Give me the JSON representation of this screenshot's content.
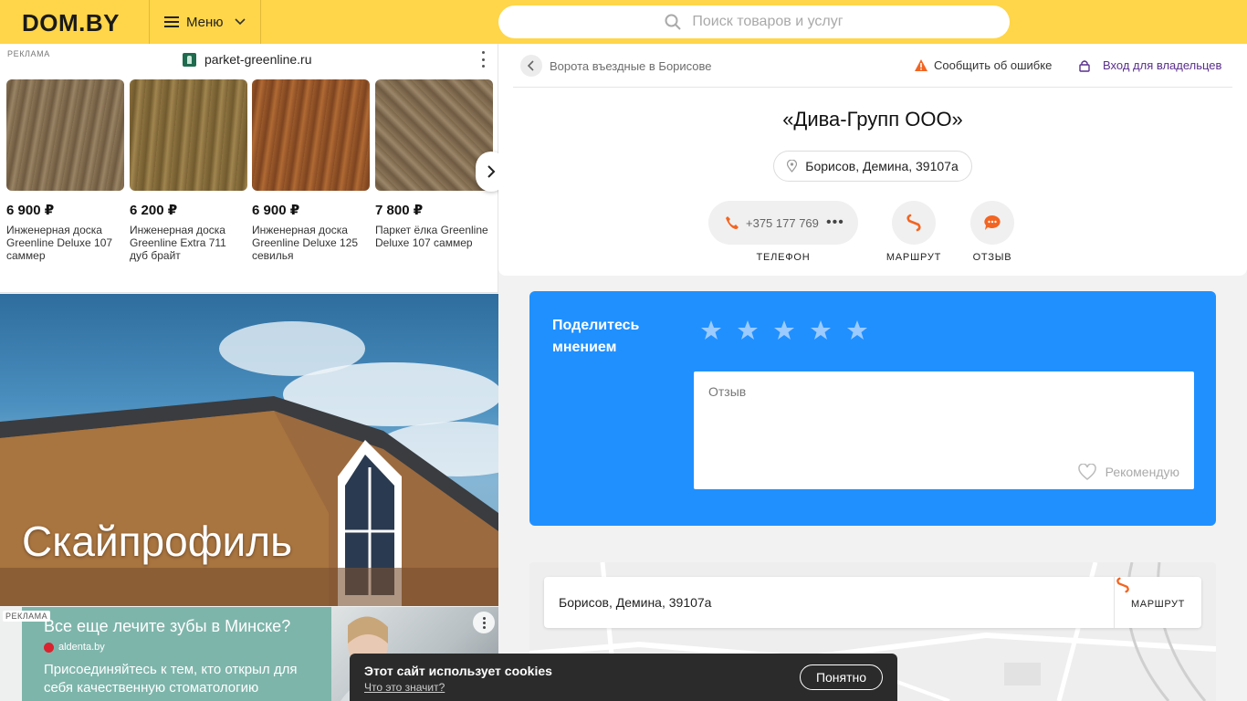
{
  "header": {
    "logo": "DOM.BY",
    "menu_label": "Меню",
    "search_placeholder": "Поиск товаров и услуг"
  },
  "ad_top": {
    "label": "РЕКЛАМА",
    "domain": "parket-greenline.ru",
    "products": [
      {
        "price": "6 900 ₽",
        "name": "Инженерная доска Greenline Deluxe 107 саммер"
      },
      {
        "price": "6 200 ₽",
        "name": "Инженерная доска Greenline Extra 711 дуб брайт"
      },
      {
        "price": "6 900 ₽",
        "name": "Инженерная доска Greenline Deluxe 125 севилья"
      },
      {
        "price": "7 800 ₽",
        "name": "Паркет ёлка Greenline Deluxe 107 саммер"
      }
    ]
  },
  "banner": {
    "title": "Скайпрофиль"
  },
  "ad_bottom": {
    "label": "РЕКЛАМА",
    "title": "Все еще лечите зубы в Минске?",
    "domain": "aldenta.by",
    "text": "Присоединяйтесь к тем, кто открыл для себя качественную стоматологию"
  },
  "company_card": {
    "breadcrumb": "Ворота въездные в Борисове",
    "report_label": "Сообщить об ошибке",
    "owner_label": "Вход для владельцев",
    "name": "«Дива-Групп ООО»",
    "address": "Борисов, Демина, 39107а",
    "phone": "+375 177 769",
    "phone_label": "ТЕЛЕФОН",
    "route_label": "МАРШРУТ",
    "review_label": "ОТЗЫВ"
  },
  "review_form": {
    "title": "Поделитесь мнением",
    "placeholder": "Отзыв",
    "recommend_label": "Рекомендую"
  },
  "map": {
    "address": "Борисов, Демина, 39107а",
    "route_label": "МАРШРУТ"
  },
  "cookie": {
    "title": "Этот сайт использует cookies",
    "link": "Что это значит?",
    "button": "Понятно"
  },
  "colors": {
    "header_bg": "#ffd649",
    "accent_orange": "#f26522",
    "review_blue": "#2090ff",
    "owner_link": "#5a2f8c"
  }
}
